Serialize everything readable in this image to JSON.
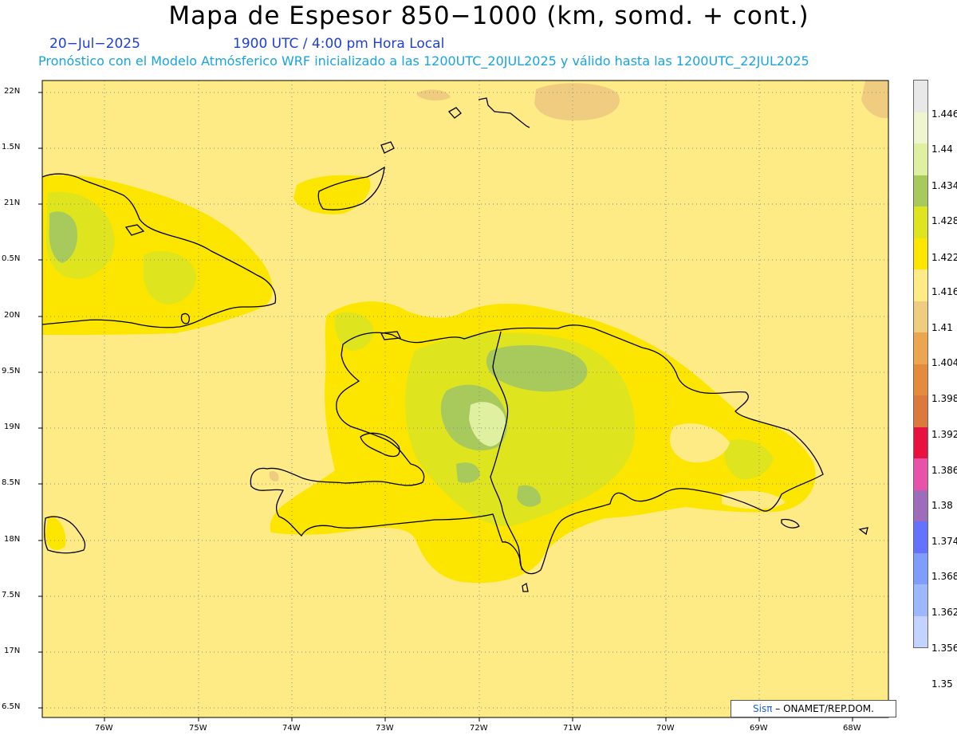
{
  "header": {
    "title": "Mapa de Espesor 850−1000 (km, somd. + cont.)",
    "date": "20−Jul−2025",
    "time": "1900 UTC / 4:00 pm Hora Local",
    "forecast_line": "Pronóstico con el Modelo Atmósferico WRF inicializado a las 1200UTC_20JUL2025 y válido hasta las  1200UTC_22JUL2025"
  },
  "axes": {
    "lat_labels": [
      "22N",
      "1.5N",
      "21N",
      "0.5N",
      "20N",
      "9.5N",
      "19N",
      "8.5N",
      "18N",
      "7.5N",
      "17N",
      "6.5N"
    ],
    "lon_labels": [
      "76W",
      "75W",
      "74W",
      "73W",
      "72W",
      "71W",
      "70W",
      "69W",
      "68W"
    ]
  },
  "colorbar": {
    "labels": [
      "1.35",
      "1.356",
      "1.362",
      "1.368",
      "1.374",
      "1.38",
      "1.386",
      "1.392",
      "1.398",
      "1.404",
      "1.41",
      "1.416",
      "1.422",
      "1.428",
      "1.434",
      "1.44",
      "1.446"
    ],
    "colors": [
      "#c4d2ff",
      "#9db8ff",
      "#7f9cff",
      "#6472ff",
      "#9d6dbb",
      "#e653a8",
      "#e8113f",
      "#db7a3c",
      "#e58c3c",
      "#eda650",
      "#f0cc80",
      "#ffeb86",
      "#fce600",
      "#dee41e",
      "#a8c95c",
      "#dff0a0",
      "#eef5d0",
      "#e8e8e8"
    ]
  },
  "map_colors": {
    "background": "#ffeb86",
    "level_1416": "#fce600",
    "level_1422": "#dee41e",
    "level_1428": "#a8c95c",
    "level_1434": "#dff0a0",
    "level_1404": "#f0cc80"
  },
  "credit": {
    "logo": "Sisπ",
    "text": " – ONAMET/REP.DOM."
  }
}
